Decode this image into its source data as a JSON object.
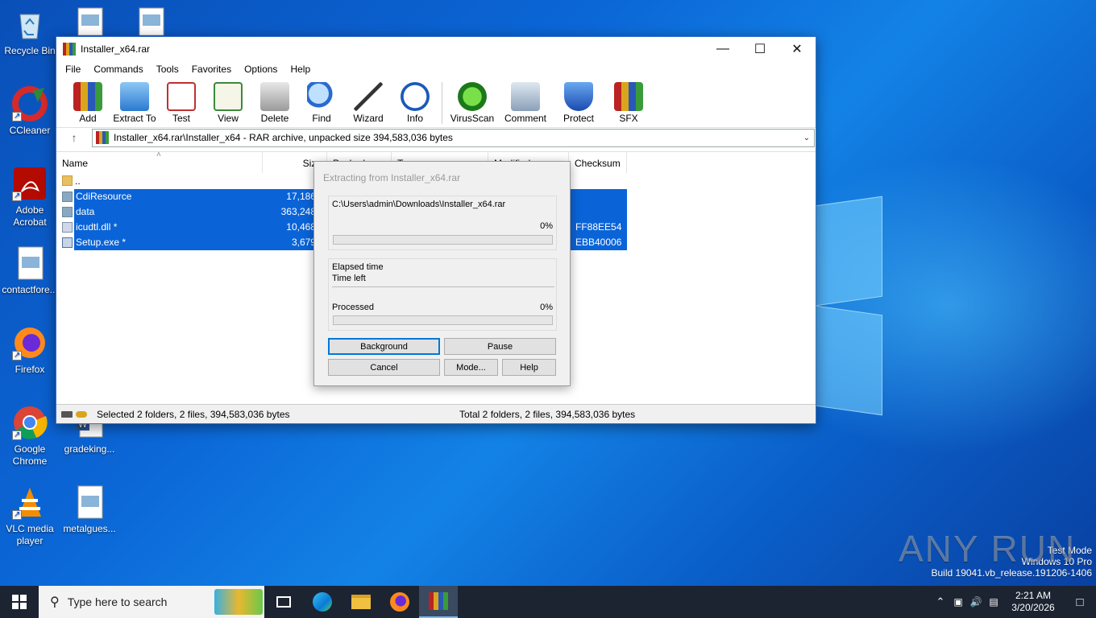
{
  "desktop": {
    "icons": [
      {
        "label": "Recycle Bin"
      },
      {
        "label": "CCleaner"
      },
      {
        "label": "Adobe Acrobat"
      },
      {
        "label": "contactfore..."
      },
      {
        "label": "Firefox"
      },
      {
        "label": "Google Chrome"
      },
      {
        "label": "VLC media player"
      },
      {
        "label": "gradeking..."
      },
      {
        "label": "metalgues..."
      }
    ],
    "watermark": {
      "brand": "ANY RUN",
      "line1": "Test Mode",
      "line2": "Windows 10 Pro",
      "line3": "Build 19041.vb_release.191206-1406"
    }
  },
  "window": {
    "title": "Installer_x64.rar",
    "menu": [
      "File",
      "Commands",
      "Tools",
      "Favorites",
      "Options",
      "Help"
    ],
    "toolbar": [
      "Add",
      "Extract To",
      "Test",
      "View",
      "Delete",
      "Find",
      "Wizard",
      "Info",
      "VirusScan",
      "Comment",
      "Protect",
      "SFX"
    ],
    "address": "Installer_x64.rar\\Installer_x64 - RAR archive, unpacked size 394,583,036 bytes",
    "columns": [
      "Name",
      "Size",
      "Packed",
      "Type",
      "Modified",
      "Checksum"
    ],
    "files": [
      {
        "name": "..",
        "size": "",
        "checksum": ""
      },
      {
        "name": "CdiResource",
        "size": "17,186,9",
        "checksum": ""
      },
      {
        "name": "data",
        "size": "363,248,6",
        "checksum": ""
      },
      {
        "name": "icudtl.dll *",
        "size": "10,468,2",
        "checksum": "FF88EE54"
      },
      {
        "name": "Setup.exe *",
        "size": "3,679,2",
        "checksum": "EBB40006"
      }
    ],
    "status_left": "Selected 2 folders, 2 files, 394,583,036 bytes",
    "status_right": "Total 2 folders, 2 files, 394,583,036 bytes"
  },
  "dialog": {
    "title": "Extracting from Installer_x64.rar",
    "path": "C:\\Users\\admin\\Downloads\\Installer_x64.rar",
    "file_percent": "0%",
    "file_progress": 0,
    "elapsed_label": "Elapsed time",
    "timeleft_label": "Time left",
    "processed_label": "Processed",
    "processed_percent": "0%",
    "processed_progress": 0,
    "buttons": {
      "background": "Background",
      "pause": "Pause",
      "cancel": "Cancel",
      "mode": "Mode...",
      "help": "Help"
    }
  },
  "taskbar": {
    "search_placeholder": "Type here to search",
    "time": "2:21 AM",
    "date": "3/20/2026"
  }
}
